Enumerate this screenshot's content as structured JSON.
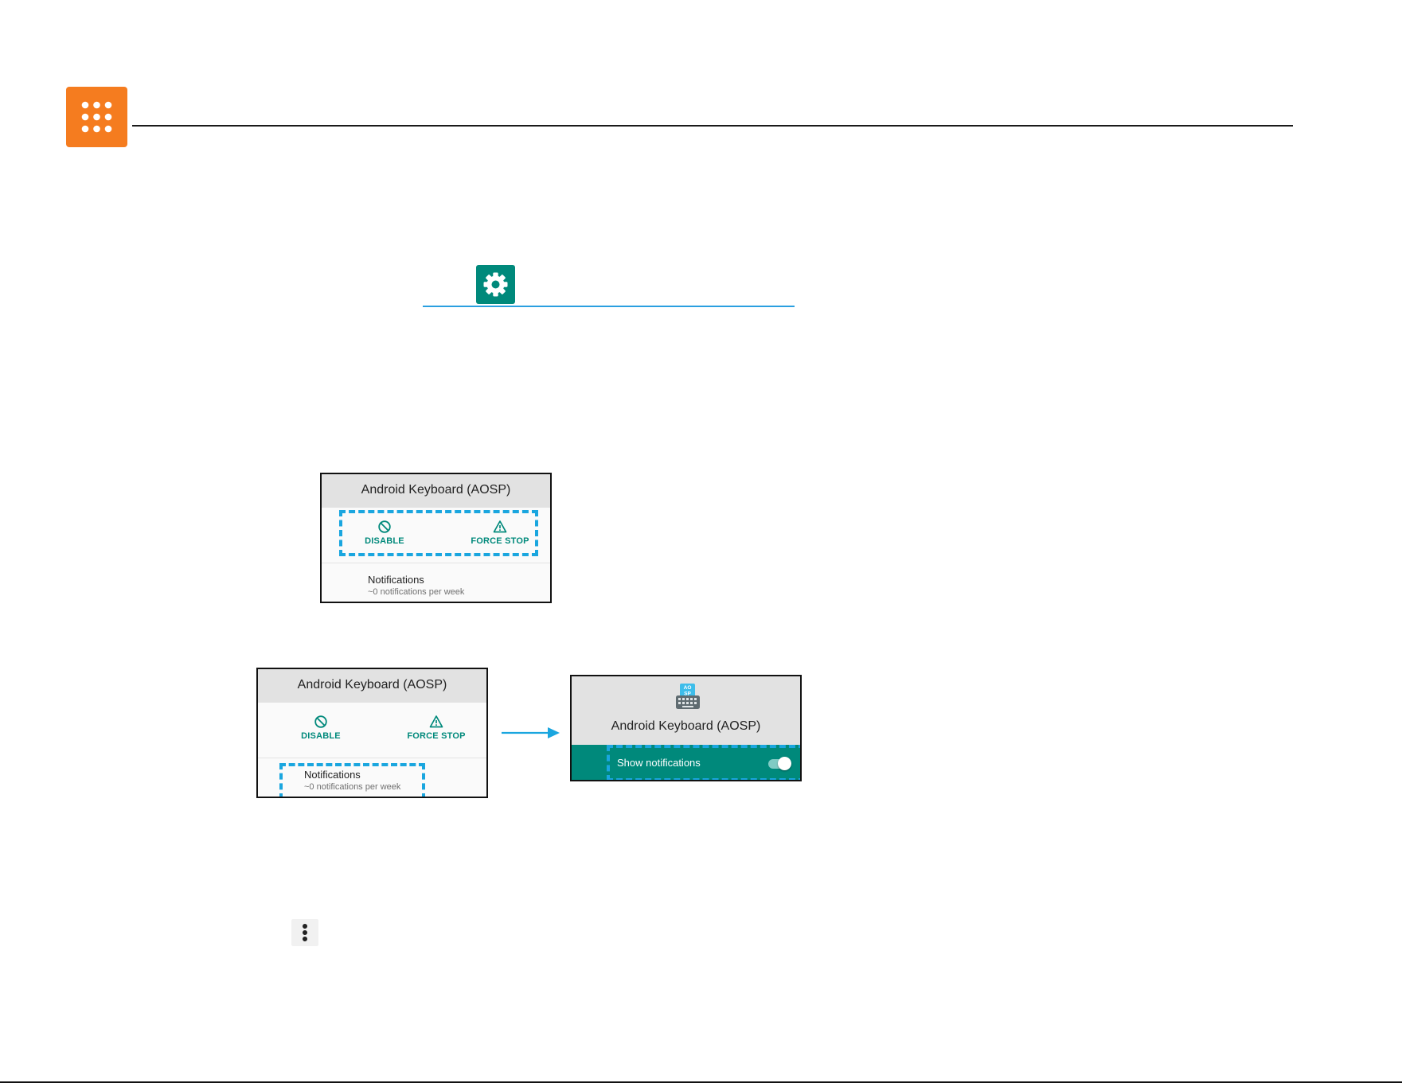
{
  "header": {
    "apps_icon": "apps-grid-icon",
    "apps_color": "#f57c1f"
  },
  "settings": {
    "icon": "gear-icon",
    "color": "#00897b"
  },
  "card1": {
    "title": "Android Keyboard (AOSP)",
    "disable_label": "DISABLE",
    "disable_icon": "block-icon",
    "force_stop_label": "FORCE STOP",
    "force_stop_icon": "warning-icon",
    "notifications_title": "Notifications",
    "notifications_sub": "~0 notifications per week"
  },
  "card2": {
    "title": "Android Keyboard (AOSP)",
    "disable_label": "DISABLE",
    "force_stop_label": "FORCE STOP",
    "notifications_title": "Notifications",
    "notifications_sub": "~0 notifications per week"
  },
  "card3": {
    "app_icon": "keyboard-icon",
    "title": "Android Keyboard (AOSP)",
    "show_notifications_label": "Show notifications",
    "toggle_on": true
  },
  "more": {
    "icon": "more-vert-icon"
  },
  "colors": {
    "teal": "#00897b",
    "highlight": "#1aa6df",
    "orange": "#f57c1f"
  }
}
